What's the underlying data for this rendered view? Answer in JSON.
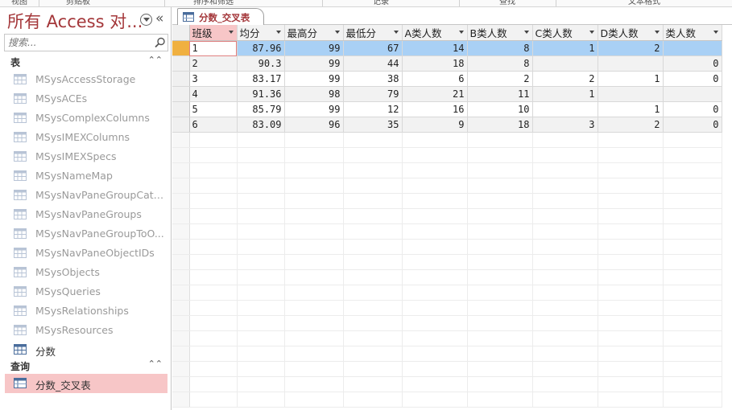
{
  "ribbon": {
    "groups": [
      "视图",
      "剪贴板",
      "排序和筛选",
      "记录",
      "查找",
      "文本格式"
    ]
  },
  "nav": {
    "title": "所有 Access 对...",
    "search_placeholder": "搜索...",
    "groups": {
      "tables_label": "表",
      "queries_label": "查询"
    },
    "tables": [
      "MSysAccessStorage",
      "MSysACEs",
      "MSysComplexColumns",
      "MSysIMEXColumns",
      "MSysIMEXSpecs",
      "MSysNameMap",
      "MSysNavPaneGroupCate...",
      "MSysNavPaneGroups",
      "MSysNavPaneGroupToO...",
      "MSysNavPaneObjectIDs",
      "MSysObjects",
      "MSysQueries",
      "MSysRelationships",
      "MSysResources",
      "分数"
    ],
    "queries": [
      "分数_交叉表"
    ]
  },
  "document": {
    "tab_label": "分数_交叉表"
  },
  "datasheet": {
    "columns": [
      "班级",
      "均分",
      "最高分",
      "最低分",
      "A类人数",
      "B类人数",
      "C类人数",
      "D类人数",
      "类人数"
    ],
    "rows": [
      [
        "1",
        "87.96",
        "99",
        "67",
        "14",
        "8",
        "1",
        "2",
        ""
      ],
      [
        "2",
        "90.3",
        "99",
        "44",
        "18",
        "8",
        "",
        "",
        "0"
      ],
      [
        "3",
        "83.17",
        "99",
        "38",
        "6",
        "2",
        "2",
        "1",
        "0"
      ],
      [
        "4",
        "91.36",
        "98",
        "79",
        "21",
        "11",
        "1",
        "",
        ""
      ],
      [
        "5",
        "85.79",
        "99",
        "12",
        "16",
        "10",
        "",
        "1",
        "0"
      ],
      [
        "6",
        "83.09",
        "96",
        "35",
        "9",
        "18",
        "3",
        "2",
        "0"
      ]
    ]
  },
  "colors": {
    "accent": "#a4373a",
    "selected_nav": "#f7c6c7",
    "selected_row": "#a9d0f5",
    "record_selector_current": "#f0b040"
  }
}
